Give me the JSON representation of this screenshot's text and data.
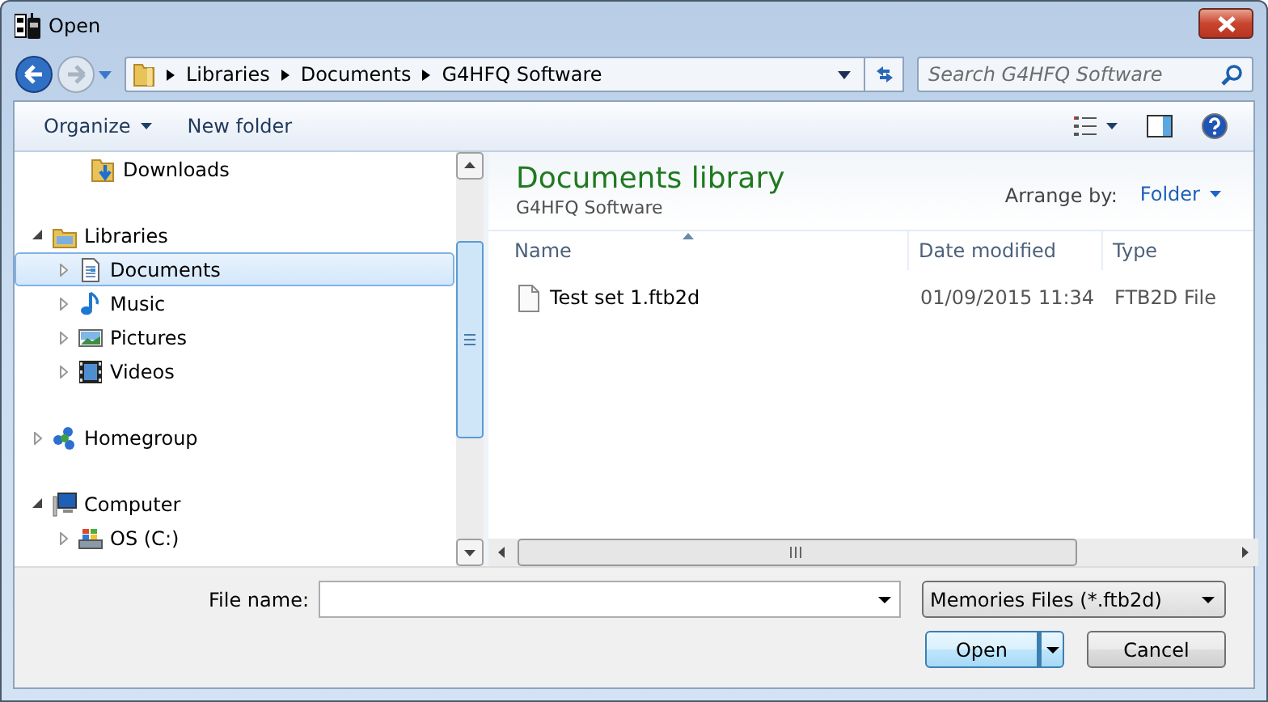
{
  "window": {
    "title": "Open"
  },
  "navigation": {
    "back": {
      "disabled": false
    },
    "forward": {
      "disabled": true
    }
  },
  "address_bar": {
    "crumbs": [
      "Libraries",
      "Documents",
      "G4HFQ Software"
    ]
  },
  "search": {
    "placeholder": "Search G4HFQ Software"
  },
  "toolbar": {
    "buttons": [
      {
        "label": "Organize",
        "has_menu": true
      },
      {
        "label": "New folder",
        "has_menu": false
      }
    ]
  },
  "nav_pane": {
    "favorites": [
      {
        "label": "Downloads",
        "kind": "downloads",
        "selected": false
      }
    ],
    "tree": [
      {
        "label": "Libraries",
        "kind": "libraries",
        "expanded": true,
        "selected": false,
        "children": [
          {
            "label": "Documents",
            "kind": "documents",
            "expanded": false,
            "selected": true
          },
          {
            "label": "Music",
            "kind": "music",
            "expanded": false,
            "selected": false
          },
          {
            "label": "Pictures",
            "kind": "pictures",
            "expanded": false,
            "selected": false
          },
          {
            "label": "Videos",
            "kind": "videos",
            "expanded": false,
            "selected": false
          }
        ]
      },
      {
        "label": "Homegroup",
        "kind": "homegroup",
        "expanded": false,
        "selected": false
      },
      {
        "label": "Computer",
        "kind": "computer",
        "expanded": true,
        "selected": false,
        "children": [
          {
            "label": "OS (C:)",
            "kind": "drive",
            "expanded": false,
            "selected": false
          }
        ]
      }
    ]
  },
  "library": {
    "title": "Documents library",
    "subtitle": "G4HFQ Software",
    "arrange_label": "Arrange by:",
    "arrange_value": "Folder"
  },
  "file_list": {
    "columns": [
      {
        "label": "Name",
        "sorted": true
      },
      {
        "label": "Date modified",
        "sorted": false
      },
      {
        "label": "Type",
        "sorted": false
      }
    ],
    "rows": [
      {
        "name": "Test set 1.ftb2d",
        "date_modified": "01/09/2015 11:34",
        "type": "FTB2D File",
        "selected": false
      }
    ]
  },
  "file_name": {
    "label": "File name:"
  },
  "file_type": {
    "value": "Memories Files (*.ftb2d)"
  },
  "buttons": [
    {
      "label": "Open",
      "kind": "split",
      "default": true
    },
    {
      "label": "Cancel",
      "kind": "plain",
      "default": false
    }
  ]
}
